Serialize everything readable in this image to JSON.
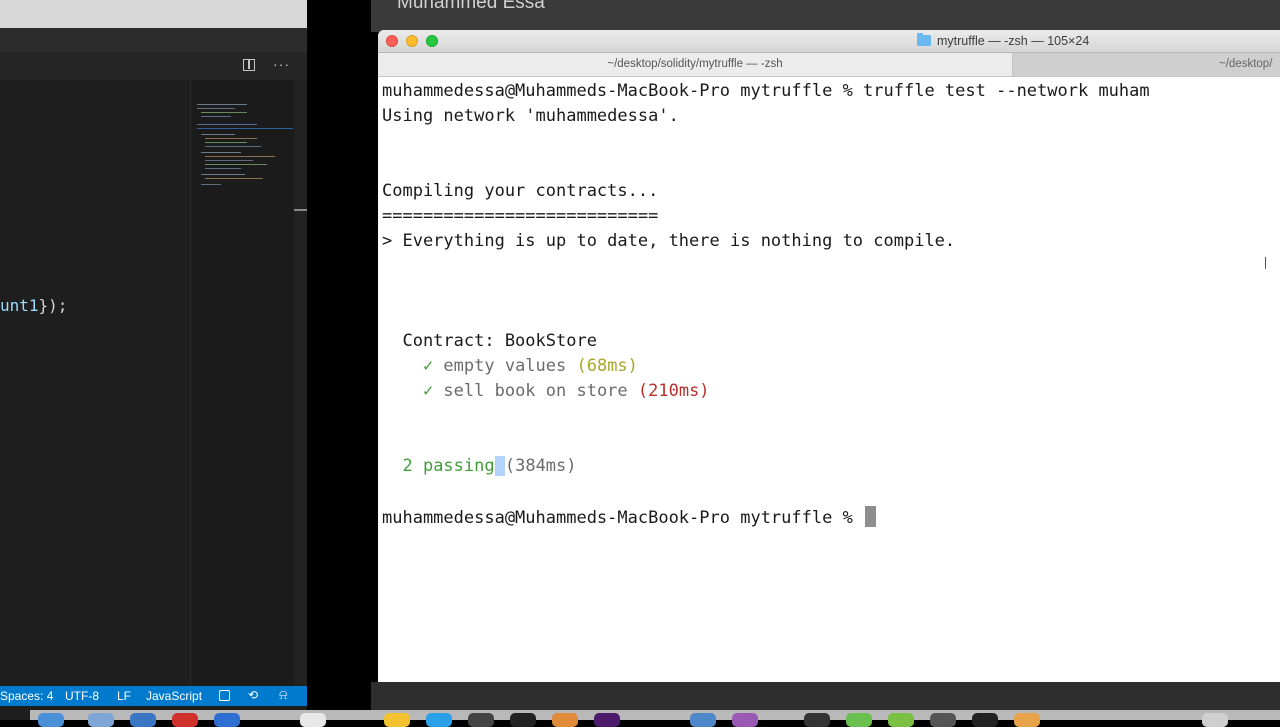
{
  "presenter": {
    "name": "Muhammed Essa"
  },
  "vscode": {
    "code_line_visible": "unt1",
    "code_line_suffix": "});",
    "status": {
      "spaces": "Spaces: 4",
      "encoding": "UTF-8",
      "eol": "LF",
      "language": "JavaScript"
    }
  },
  "terminal": {
    "title": "mytruffle — -zsh — 105×24",
    "tabs": [
      {
        "label": "~/desktop/solidity/mytruffle — -zsh",
        "active": true
      },
      {
        "label": "~/desktop/"
      }
    ],
    "lines": {
      "cmd_prompt": "muhammedessa@Muhammeds-MacBook-Pro mytruffle % ",
      "cmd": "truffle test --network muham",
      "using_network": "Using network 'muhammedessa'.",
      "compiling": "Compiling your contracts...",
      "underline": "===========================",
      "up_to_date": "> Everything is up to date, there is nothing to compile.",
      "contract": "  Contract: BookStore",
      "test1_check": "    ✓ ",
      "test1_name": "empty values ",
      "test1_time": "(68ms)",
      "test2_check": "    ✓ ",
      "test2_name": "sell book on store ",
      "test2_time": "(210ms)",
      "passing_prefix": "  ",
      "passing": "2 passing",
      "passing_time": "(384ms)",
      "final_prompt": "muhammedessa@Muhammeds-MacBook-Pro mytruffle % "
    }
  },
  "colors": {
    "vscode_status": "#007acc",
    "pass_green": "#3f9e36",
    "time_yellow": "#a8a62a",
    "time_red": "#b9312b"
  }
}
